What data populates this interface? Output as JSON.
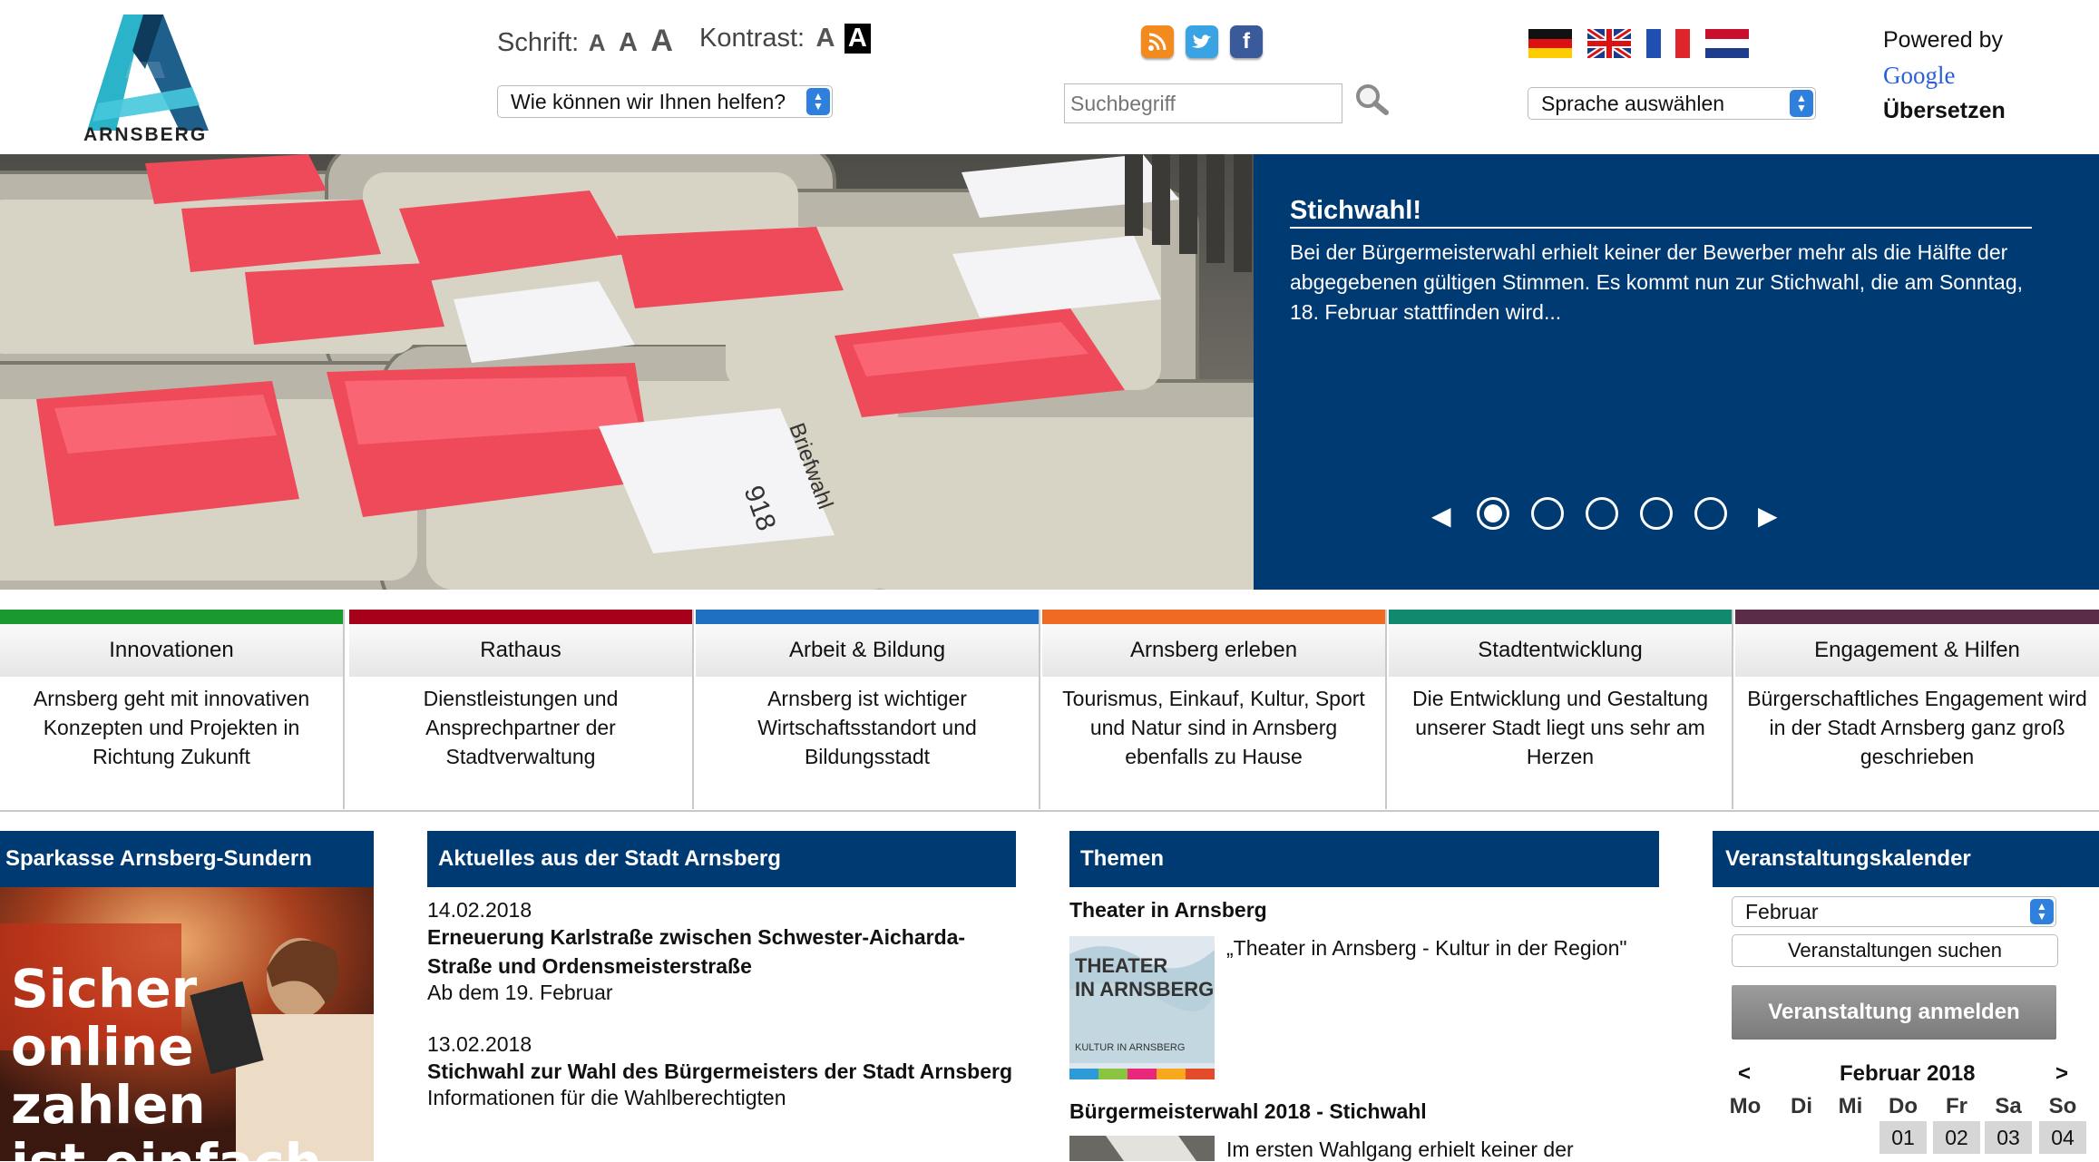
{
  "header": {
    "logo_text": "ARNSBERG",
    "font_label": "Schrift:",
    "font_sizes": [
      "A",
      "A",
      "A"
    ],
    "contrast_label": "Kontrast:",
    "contrast_options": [
      "A",
      "A"
    ],
    "help_select": "Wie können wir Ihnen helfen?",
    "search_placeholder": "Suchbegriff",
    "language_select": "Sprache auswählen",
    "powered_by": "Powered by",
    "google": "Google",
    "translate": "Übersetzen",
    "social_icons": [
      "rss-icon",
      "twitter-icon",
      "facebook-icon"
    ],
    "flags": [
      "flag-de",
      "flag-uk",
      "flag-fr",
      "flag-nl"
    ]
  },
  "hero": {
    "title": "Stichwahl!",
    "text": "Bei der Bürgermeisterwahl erhielt keiner der Bewerber mehr als die Hälfte der abgegebenen gültigen Stimmen. Es kommt nun zur Stichwahl, die am Sonntag, 18. Februar stattfinden wird...",
    "slide_count": 5,
    "active_slide": 1,
    "image_labels": [
      "918",
      "Briefwahl"
    ]
  },
  "categories": [
    {
      "title": "Innovationen",
      "color": "#1a9a2e",
      "desc": "Arnsberg geht mit innovativen Konzepten und Projekten in Richtung Zukunft"
    },
    {
      "title": "Rathaus",
      "color": "#a6001a",
      "desc": "Dienstleistungen und Ansprechpartner der Stadtverwaltung"
    },
    {
      "title": "Arbeit  &  Bildung",
      "color": "#1f6fc2",
      "desc": "Arnsberg ist wichtiger Wirtschaftsstandort und Bildungsstadt"
    },
    {
      "title": "Arnsberg erleben",
      "color": "#f06a22",
      "desc": "Tourismus, Einkauf, Kultur, Sport und Natur sind in Arnsberg ebenfalls zu Hause"
    },
    {
      "title": "Stadtentwicklung",
      "color": "#0f8a6e",
      "desc": "Die Entwicklung und Gestaltung unserer Stadt liegt uns sehr am Herzen"
    },
    {
      "title": "Engagement  &  Hilfen",
      "color": "#5a2c48",
      "desc": "Bürgerschaftliches Engagement wird in der Stadt Arnsberg ganz groß geschrieben"
    }
  ],
  "sparkasse": {
    "heading": "Sparkasse Arnsberg-Sundern",
    "ad_lines": [
      "Sicher",
      "online zahlen",
      "ist einfach."
    ]
  },
  "news": {
    "heading": "Aktuelles aus der Stadt Arnsberg",
    "items": [
      {
        "date": "14.02.2018",
        "title": "Erneuerung Karlstraße zwischen Schwester-Aicharda-Straße und Ordensmeisterstraße",
        "sub": "Ab dem 19. Februar"
      },
      {
        "date": "13.02.2018",
        "title": "Stichwahl zur Wahl des Bürgermeisters der Stadt Arnsberg",
        "sub": "Informationen für die Wahlberechtigten"
      }
    ]
  },
  "themen": {
    "heading": "Themen",
    "items": [
      {
        "title": "Theater in Arnsberg",
        "text": "„Theater in Arnsberg - Kultur in der Region\"",
        "thumb_lines": [
          "THEATER",
          "IN ARNSBERG",
          "KULTUR IN ARNSBERG"
        ]
      },
      {
        "title": "Bürgermeisterwahl 2018 - Stichwahl",
        "text": "Im ersten Wahlgang erhielt keiner der"
      }
    ]
  },
  "calendar": {
    "heading": "Veranstaltungskalender",
    "month_select": "Februar",
    "search_button": "Veranstaltungen suchen",
    "register_button": "Veranstaltung anmelden",
    "prev": "<",
    "next": ">",
    "month_label": "Februar 2018",
    "weekdays": [
      "Mo",
      "Di",
      "Mi",
      "Do",
      "Fr",
      "Sa",
      "So"
    ],
    "first_row_days": [
      "01",
      "02",
      "03",
      "04"
    ]
  }
}
